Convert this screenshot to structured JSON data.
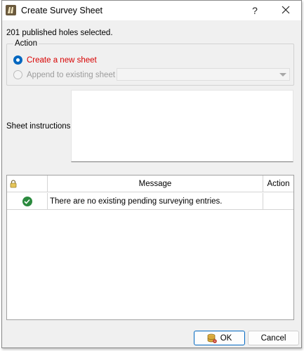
{
  "window": {
    "title": "Create Survey Sheet",
    "help_label": "?",
    "app_icon": "app-logo-icon",
    "close_icon": "close-icon"
  },
  "summary": {
    "selected_text": "201 published holes selected."
  },
  "action": {
    "legend": "Action",
    "options": [
      {
        "label": "Create a new sheet",
        "checked": true,
        "enabled": true
      },
      {
        "label": "Append to existing sheet",
        "checked": false,
        "enabled": false
      }
    ],
    "existing_sheet_value": ""
  },
  "instructions": {
    "label": "Sheet instructions",
    "value": ""
  },
  "table": {
    "columns": [
      {
        "key": "lock",
        "label": "",
        "icon": "lock-icon"
      },
      {
        "key": "message",
        "label": "Message"
      },
      {
        "key": "action",
        "label": "Action"
      }
    ],
    "rows": [
      {
        "status_icon": "check-circle-icon",
        "message": "There are no existing pending surveying entries.",
        "action": ""
      }
    ]
  },
  "buttons": {
    "ok_label": "OK",
    "ok_icon": "database-icon",
    "cancel_label": "Cancel"
  },
  "colors": {
    "accent": "#0067c0",
    "selected_option_text": "#d80000",
    "success": "#2b8a3e"
  }
}
